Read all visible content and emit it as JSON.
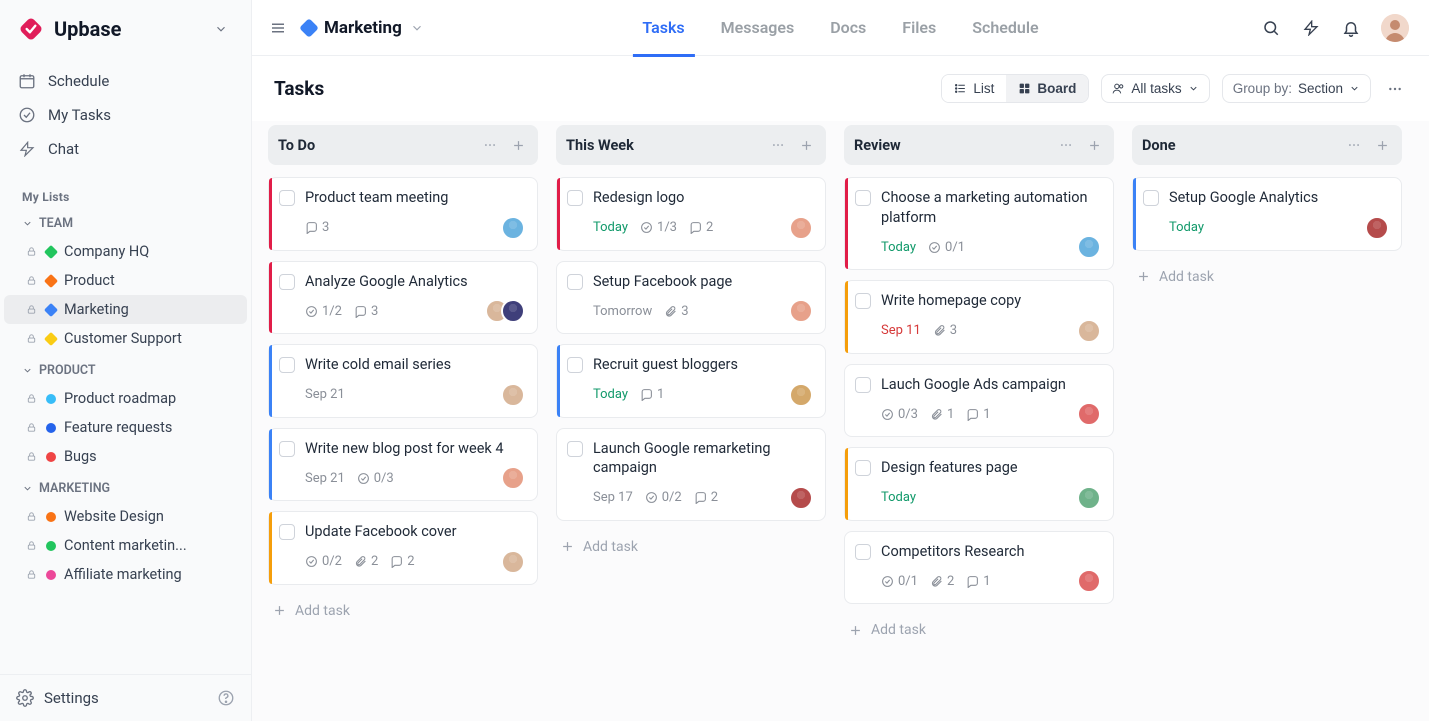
{
  "brand": "Upbase",
  "sidebar": {
    "nav": [
      {
        "label": "Schedule",
        "icon": "calendar-icon"
      },
      {
        "label": "My Tasks",
        "icon": "check-circle-icon"
      },
      {
        "label": "Chat",
        "icon": "bolt-icon"
      }
    ],
    "my_lists_title": "My Lists",
    "groups": [
      {
        "name": "TEAM",
        "items": [
          {
            "label": "Company HQ",
            "color": "#22c55e",
            "shape": "diamond"
          },
          {
            "label": "Product",
            "color": "#f97316",
            "shape": "diamond"
          },
          {
            "label": "Marketing",
            "color": "#3b82f6",
            "shape": "diamond",
            "active": true
          },
          {
            "label": "Customer Support",
            "color": "#facc15",
            "shape": "diamond"
          }
        ]
      },
      {
        "name": "PRODUCT",
        "items": [
          {
            "label": "Product roadmap",
            "color": "#38bdf8",
            "shape": "round"
          },
          {
            "label": "Feature requests",
            "color": "#2563eb",
            "shape": "round"
          },
          {
            "label": "Bugs",
            "color": "#ef4444",
            "shape": "round"
          }
        ]
      },
      {
        "name": "MARKETING",
        "items": [
          {
            "label": "Website Design",
            "color": "#f97316",
            "shape": "round"
          },
          {
            "label": "Content marketin...",
            "color": "#22c55e",
            "shape": "round"
          },
          {
            "label": "Affiliate marketing",
            "color": "#ec4899",
            "shape": "round"
          }
        ]
      }
    ],
    "settings_label": "Settings"
  },
  "header": {
    "breadcrumb_title": "Marketing",
    "breadcrumb_color": "#3b82f6",
    "tabs": [
      "Tasks",
      "Messages",
      "Docs",
      "Files",
      "Schedule"
    ],
    "active_tab": "Tasks"
  },
  "tasks_page": {
    "title": "Tasks",
    "view_list_label": "List",
    "view_board_label": "Board",
    "active_view": "Board",
    "filter_label": "All tasks",
    "group_by_prefix": "Group by:",
    "group_by_value": "Section",
    "add_task_label": "Add task"
  },
  "colors": {
    "red": "#e11d48",
    "blue": "#3b82f6",
    "orange": "#f59e0b"
  },
  "avatars": {
    "a1": "#6bb3e0",
    "a2": "#e7a18a",
    "a3": "#d9b79b",
    "a4": "#b54b4b",
    "a5": "#3f3f7a",
    "a6": "#d4a86a",
    "a7": "#6fb28a",
    "a8": "#e06a6a"
  },
  "board": [
    {
      "name": "To Do",
      "cards": [
        {
          "title": "Product team meeting",
          "stripe": "red",
          "comments": 3,
          "avatars": [
            "a1"
          ]
        },
        {
          "title": "Analyze Google Analytics",
          "stripe": "red",
          "subtasks": "1/2",
          "comments": 3,
          "avatars": [
            "a3",
            "a5"
          ]
        },
        {
          "title": "Write cold email series",
          "stripe": "blue",
          "due": "Sep 21",
          "avatars": [
            "a3"
          ]
        },
        {
          "title": "Write new blog post for week 4",
          "stripe": "blue",
          "due": "Sep 21",
          "subtasks": "0/3",
          "avatars": [
            "a2"
          ]
        },
        {
          "title": "Update Facebook cover",
          "stripe": "orange",
          "subtasks": "0/2",
          "attachments": 2,
          "comments": 2,
          "avatars": [
            "a3"
          ]
        }
      ]
    },
    {
      "name": "This Week",
      "cards": [
        {
          "title": "Redesign logo",
          "stripe": "red",
          "due": "Today",
          "due_kind": "today",
          "subtasks": "1/3",
          "comments": 2,
          "avatars": [
            "a2"
          ]
        },
        {
          "title": "Setup Facebook page",
          "due": "Tomorrow",
          "attachments": 3,
          "avatars": [
            "a2"
          ]
        },
        {
          "title": "Recruit guest bloggers",
          "stripe": "blue",
          "due": "Today",
          "due_kind": "today",
          "comments": 1,
          "avatars": [
            "a6"
          ]
        },
        {
          "title": "Launch Google remarketing campaign",
          "due": "Sep 17",
          "subtasks": "0/2",
          "comments": 2,
          "avatars": [
            "a4"
          ]
        }
      ]
    },
    {
      "name": "Review",
      "cards": [
        {
          "title": "Choose a marketing automation platform",
          "stripe": "red",
          "due": "Today",
          "due_kind": "today",
          "subtasks": "0/1",
          "avatars": [
            "a1"
          ]
        },
        {
          "title": "Write homepage copy",
          "stripe": "orange",
          "due": "Sep 11",
          "due_kind": "soon",
          "attachments": 3,
          "avatars": [
            "a3"
          ]
        },
        {
          "title": "Lauch Google Ads campaign",
          "subtasks": "0/3",
          "attachments": 1,
          "comments": 1,
          "avatars": [
            "a8"
          ]
        },
        {
          "title": "Design features page",
          "stripe": "orange",
          "due": "Today",
          "due_kind": "today",
          "avatars": [
            "a7"
          ]
        },
        {
          "title": "Competitors Research",
          "subtasks": "0/1",
          "attachments": 2,
          "comments": 1,
          "avatars": [
            "a8"
          ]
        }
      ]
    },
    {
      "name": "Done",
      "cards": [
        {
          "title": "Setup Google Analytics",
          "stripe": "blue",
          "due": "Today",
          "due_kind": "today",
          "avatars": [
            "a4"
          ]
        }
      ]
    }
  ]
}
